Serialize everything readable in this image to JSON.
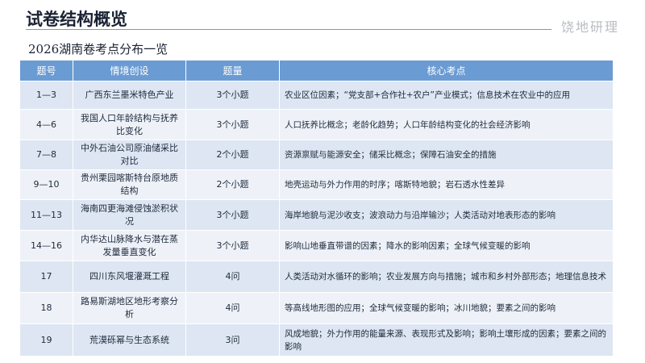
{
  "page": {
    "title": "试卷结构概览",
    "subtitle": "2026湖南卷考点分布一览",
    "watermark": "饶地研理"
  },
  "table": {
    "headers": [
      "题号",
      "情境创设",
      "题量",
      "核心考点"
    ],
    "rows": [
      {
        "no": "1—3",
        "context": "广西东兰墨米特色产业",
        "count": "3个小题",
        "core": "农业区位因素；“党支部+合作社+农户”产业模式；信息技术在农业中的应用"
      },
      {
        "no": "4—6",
        "context": "我国人口年龄结构与抚养比变化",
        "count": "3个小题",
        "core": "人口抚养比概念；老龄化趋势；人口年龄结构变化的社会经济影响"
      },
      {
        "no": "7—8",
        "context": "中外石油公司原油储采比对比",
        "count": "2个小题",
        "core": "资源禀赋与能源安全；储采比概念；保障石油安全的措施"
      },
      {
        "no": "9—10",
        "context": "贵州栗园喀斯特台原地质结构",
        "count": "2个小题",
        "core": "地壳运动与外力作用的时序；喀斯特地貌；岩石透水性差异"
      },
      {
        "no": "11—13",
        "context": "海南四更海滩侵蚀淤积状况",
        "count": "3个小题",
        "core": "海岸地貌与泥沙收支；波浪动力与沿岸输沙；人类活动对地表形态的影响"
      },
      {
        "no": "14—16",
        "context": "内华达山脉降水与潜在蒸发量垂直变化",
        "count": "3个小题",
        "core": "影响山地垂直带谱的因素；降水的影响因素；全球气候变暖的影响"
      },
      {
        "no": "17",
        "context": "四川东风堰灌溉工程",
        "count": "4问",
        "core": "人类活动对水循环的影响；农业发展方向与措施；城市和乡村外部形态；地理信息技术"
      },
      {
        "no": "18",
        "context": "路易斯湖地区地形考察分析",
        "count": "4问",
        "core": "等高线地形图的应用；全球气候变暖的影响；冰川地貌；要素之间的影响"
      },
      {
        "no": "19",
        "context": "荒漠砾幂与生态系统",
        "count": "3问",
        "core": "风成地貌；外力作用的能量来源、表现形式及影响；影响土壤形成的因素；要素之间的影响"
      }
    ]
  },
  "colors": {
    "header_bg": "#6b9bd3",
    "row_odd": "#dde6f2",
    "row_even": "#eef2f8",
    "title_rule": "#7fa86a"
  }
}
